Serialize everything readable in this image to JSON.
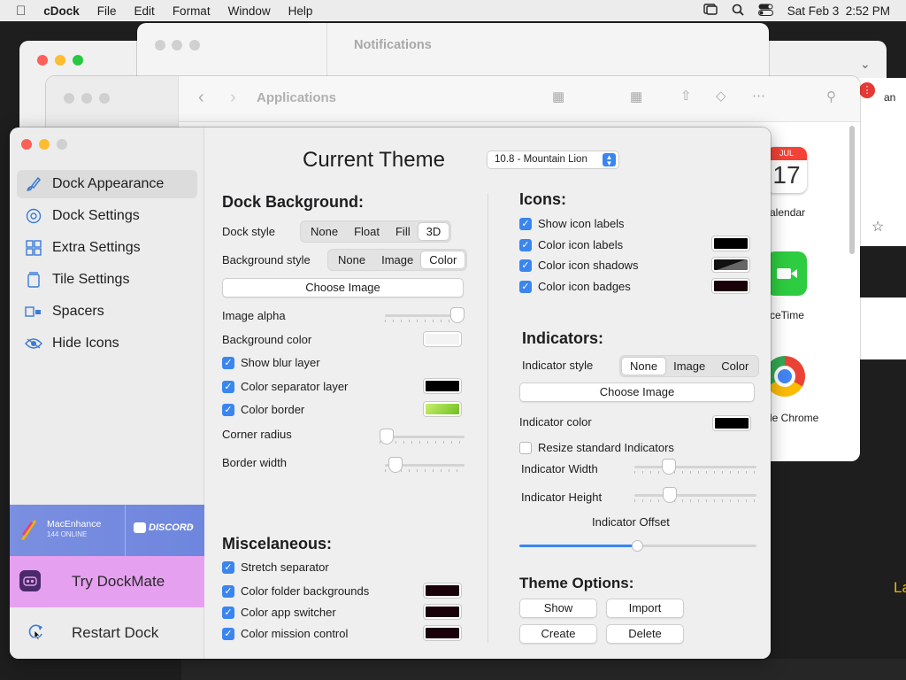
{
  "menubar": {
    "app_name": "cDock",
    "items": [
      "File",
      "Edit",
      "Format",
      "Window",
      "Help"
    ],
    "datetime": "Sat Feb 3  2:52 PM"
  },
  "background": {
    "notifications_title": "Notifications",
    "applications_title": "Applications",
    "calendar_month": "JUL",
    "calendar_day": "17",
    "app_labels": [
      "alendar",
      "ceTime",
      "le Chrome"
    ],
    "right_edge_text": "an",
    "far_right_text": "La"
  },
  "window": {
    "title": "Current Theme",
    "theme_select": "10.8 - Mountain Lion"
  },
  "sidebar": {
    "items": [
      {
        "label": "Dock Appearance",
        "icon": "paintbrush-icon"
      },
      {
        "label": "Dock Settings",
        "icon": "gear-icon"
      },
      {
        "label": "Extra Settings",
        "icon": "grid-icon"
      },
      {
        "label": "Tile Settings",
        "icon": "tile-icon"
      },
      {
        "label": "Spacers",
        "icon": "spacer-icon"
      },
      {
        "label": "Hide Icons",
        "icon": "eye-icon"
      }
    ],
    "promo_discord": {
      "name": "MacEnhance",
      "online": "144 ONLINE",
      "badge": "DISCORD"
    },
    "try_dockmate": "Try DockMate",
    "restart_dock": "Restart Dock"
  },
  "dock_background": {
    "title": "Dock Background:",
    "dock_style_label": "Dock style",
    "dock_style_options": [
      "None",
      "Float",
      "Fill",
      "3D"
    ],
    "dock_style_selected": "3D",
    "bg_style_label": "Background style",
    "bg_style_options": [
      "None",
      "Image",
      "Color"
    ],
    "bg_style_selected": "Color",
    "choose_image": "Choose Image",
    "image_alpha_label": "Image alpha",
    "image_alpha_value": 1.0,
    "bg_color_label": "Background color",
    "show_blur": "Show blur layer",
    "color_separator": "Color separator layer",
    "color_border": "Color border",
    "corner_radius_label": "Corner radius",
    "corner_radius_value": 0.0,
    "border_width_label": "Border width",
    "border_width_value": 0.1
  },
  "misc": {
    "title": "Miscelaneous:",
    "stretch_separator": "Stretch separator",
    "color_folder": "Color folder backgrounds",
    "color_switcher": "Color app switcher",
    "color_mission": "Color mission control"
  },
  "icons": {
    "title": "Icons:",
    "show_labels": "Show icon labels",
    "color_labels": "Color icon labels",
    "color_shadows": "Color icon shadows",
    "color_badges": "Color icon badges"
  },
  "indicators": {
    "title": "Indicators:",
    "style_label": "Indicator style",
    "style_options": [
      "None",
      "Image",
      "Color"
    ],
    "style_selected": "None",
    "choose_image": "Choose Image",
    "color_label": "Indicator color",
    "resize_label": "Resize standard Indicators",
    "width_label": "Indicator Width",
    "width_value": 0.25,
    "height_label": "Indicator Height",
    "height_value": 0.27,
    "offset_label": "Indicator Offset",
    "offset_value": 0.5
  },
  "theme_options": {
    "title": "Theme Options:",
    "show": "Show",
    "import": "Import",
    "create": "Create",
    "delete": "Delete"
  },
  "colors": {
    "accent": "#3a86f0",
    "black_swatch": "#000000",
    "green_swatch": "#a6e22e",
    "dark_swatch": "#1a0008",
    "promo_pink": "#e5a0f0"
  }
}
